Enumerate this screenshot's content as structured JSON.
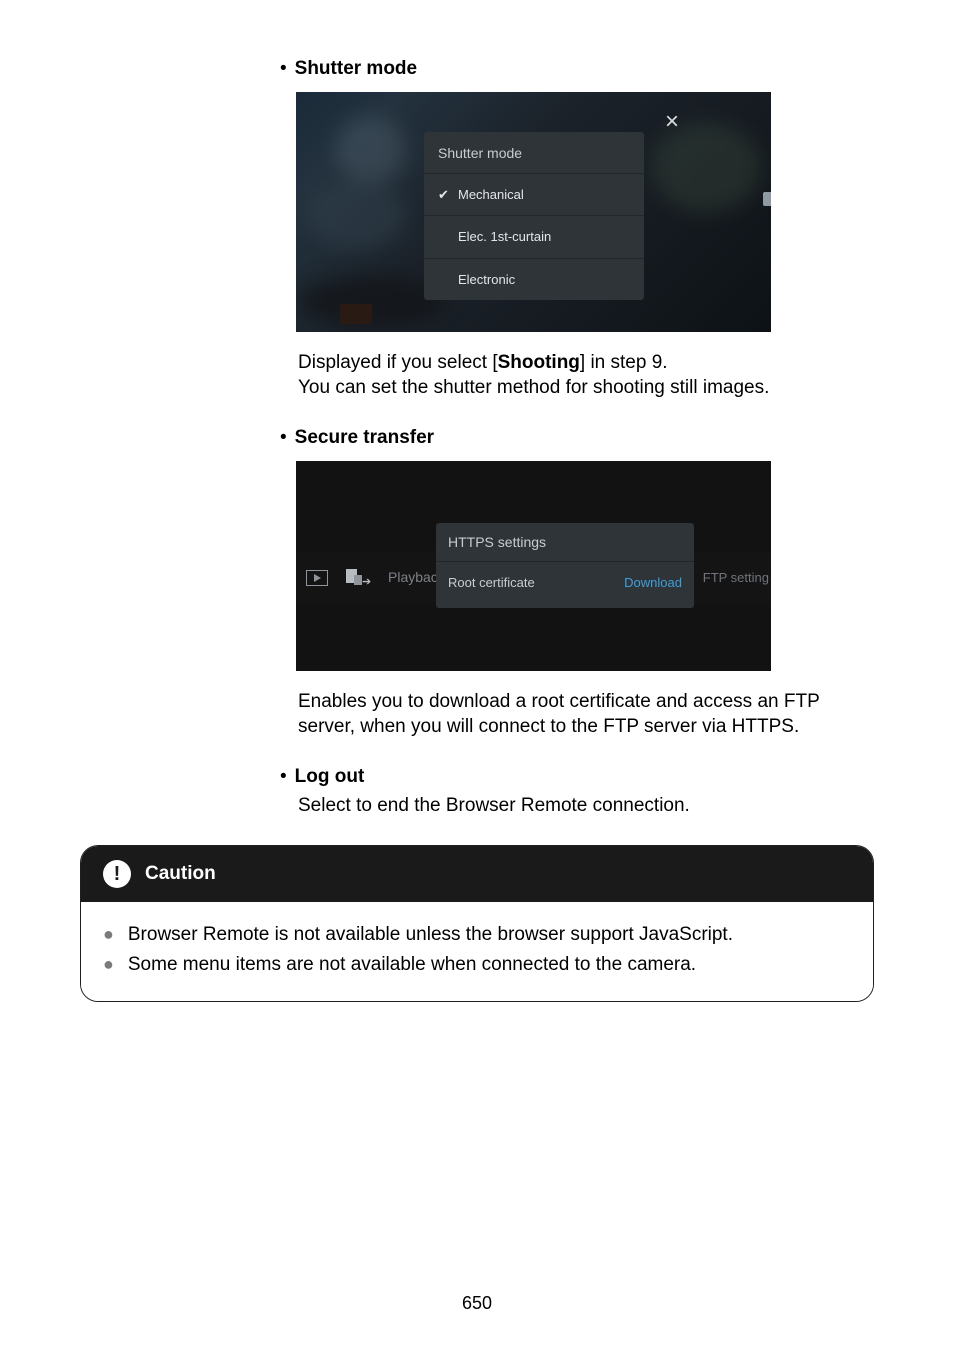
{
  "sections": {
    "shutter": {
      "bullet_label": "Shutter mode",
      "panel_title": "Shutter mode",
      "options": {
        "opt1": "Mechanical",
        "opt2": "Elec. 1st-curtain",
        "opt3": "Electronic"
      },
      "desc_line1_a": "Displayed if you select [",
      "desc_line1_bold": "Shooting",
      "desc_line1_b": "] in step 9.",
      "desc_line2": "You can set the shutter method for shooting still images."
    },
    "secure": {
      "bullet_label": "Secure transfer",
      "row_left_label": "Playback",
      "row_right_label": "FTP setting",
      "panel_title": "HTTPS settings",
      "panel_row_label": "Root certificate",
      "panel_row_action": "Download",
      "desc_line1": "Enables you to download a root certificate and access an FTP",
      "desc_line2": "server, when you will connect to the FTP server via HTTPS."
    },
    "logout": {
      "bullet_label": "Log out",
      "desc": "Select to end the Browser Remote connection."
    }
  },
  "caution": {
    "title": "Caution",
    "items": [
      "Browser Remote is not available unless the browser support JavaScript.",
      "Some menu items are not available when connected to the camera."
    ]
  },
  "glyphs": {
    "bullet": "•",
    "check": "✔",
    "close": "×",
    "exclaim": "!"
  },
  "page_number": "650"
}
